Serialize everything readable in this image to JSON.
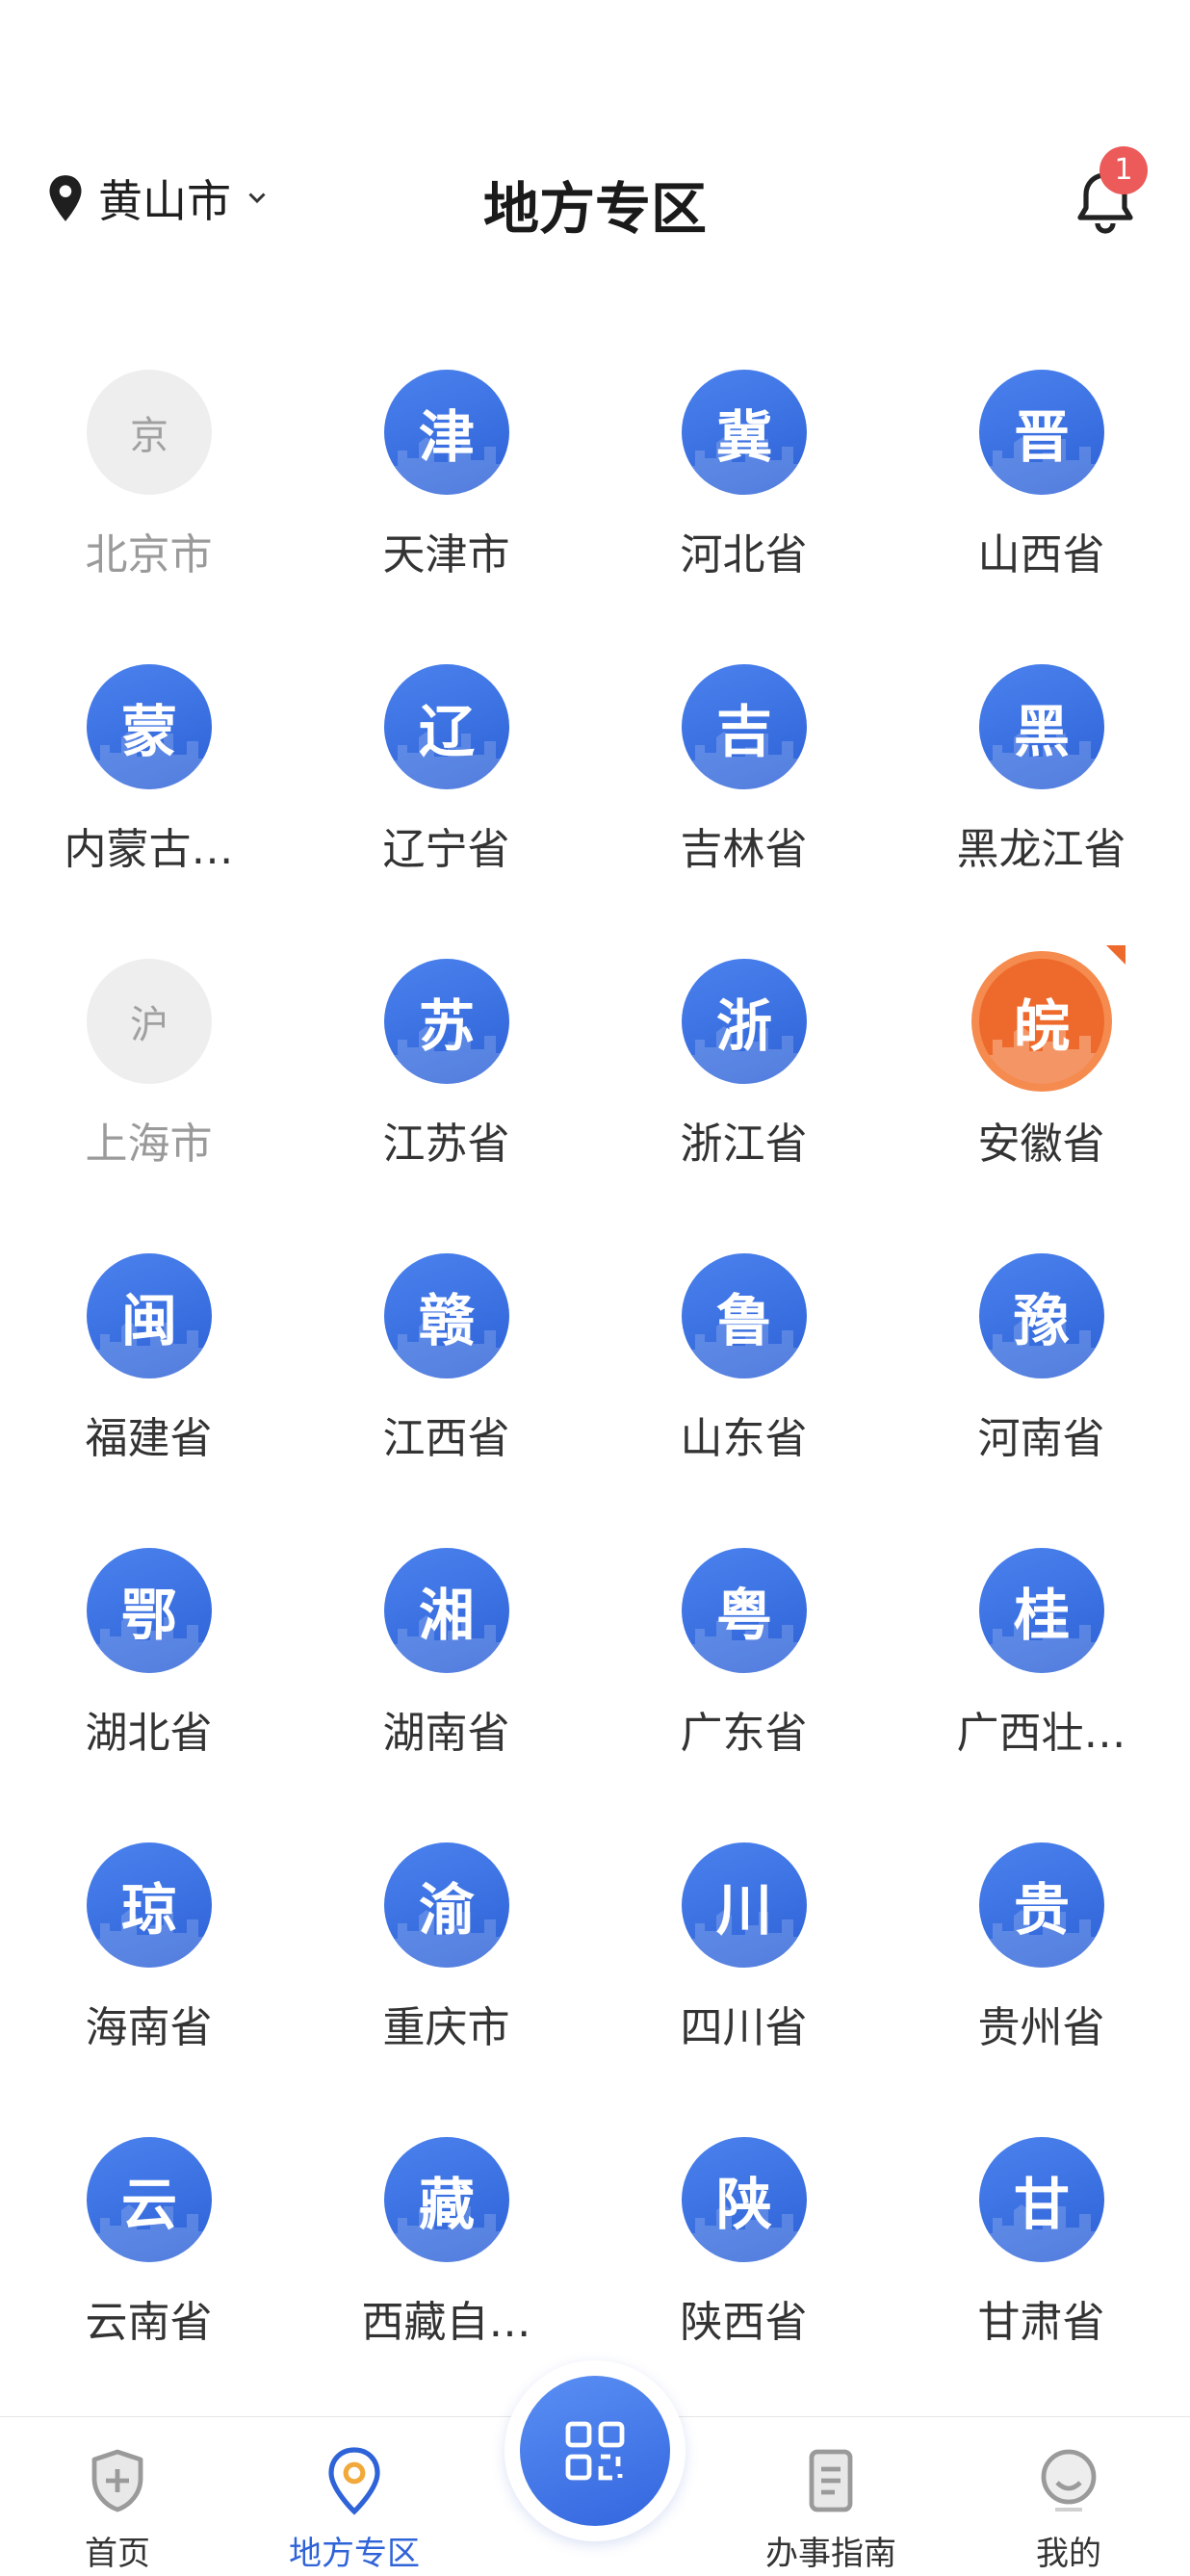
{
  "header": {
    "location": "黄山市",
    "title": "地方专区",
    "notification_count": "1"
  },
  "regions": [
    {
      "label": "北京市",
      "glyph": "京",
      "state": "inactive",
      "icon": "beijing-icon"
    },
    {
      "label": "天津市",
      "glyph": "津",
      "state": "active",
      "icon": "tianjin-icon"
    },
    {
      "label": "河北省",
      "glyph": "冀",
      "state": "active",
      "icon": "hebei-icon"
    },
    {
      "label": "山西省",
      "glyph": "晋",
      "state": "active",
      "icon": "shanxi-icon"
    },
    {
      "label": "内蒙古…",
      "glyph": "蒙",
      "state": "active",
      "icon": "neimenggu-icon"
    },
    {
      "label": "辽宁省",
      "glyph": "辽",
      "state": "active",
      "icon": "liaoning-icon"
    },
    {
      "label": "吉林省",
      "glyph": "吉",
      "state": "active",
      "icon": "jilin-icon"
    },
    {
      "label": "黑龙江省",
      "glyph": "黑",
      "state": "active",
      "icon": "heilongjiang-icon"
    },
    {
      "label": "上海市",
      "glyph": "沪",
      "state": "inactive",
      "icon": "shanghai-icon"
    },
    {
      "label": "江苏省",
      "glyph": "苏",
      "state": "active",
      "icon": "jiangsu-icon"
    },
    {
      "label": "浙江省",
      "glyph": "浙",
      "state": "active",
      "icon": "zhejiang-icon"
    },
    {
      "label": "安徽省",
      "glyph": "皖",
      "state": "selected",
      "icon": "anhui-icon"
    },
    {
      "label": "福建省",
      "glyph": "闽",
      "state": "active",
      "icon": "fujian-icon"
    },
    {
      "label": "江西省",
      "glyph": "赣",
      "state": "active",
      "icon": "jiangxi-icon"
    },
    {
      "label": "山东省",
      "glyph": "鲁",
      "state": "active",
      "icon": "shandong-icon"
    },
    {
      "label": "河南省",
      "glyph": "豫",
      "state": "active",
      "icon": "henan-icon"
    },
    {
      "label": "湖北省",
      "glyph": "鄂",
      "state": "active",
      "icon": "hubei-icon"
    },
    {
      "label": "湖南省",
      "glyph": "湘",
      "state": "active",
      "icon": "hunan-icon"
    },
    {
      "label": "广东省",
      "glyph": "粤",
      "state": "active",
      "icon": "guangdong-icon"
    },
    {
      "label": "广西壮…",
      "glyph": "桂",
      "state": "active",
      "icon": "guangxi-icon"
    },
    {
      "label": "海南省",
      "glyph": "琼",
      "state": "active",
      "icon": "hainan-icon"
    },
    {
      "label": "重庆市",
      "glyph": "渝",
      "state": "active",
      "icon": "chongqing-icon"
    },
    {
      "label": "四川省",
      "glyph": "川",
      "state": "active",
      "icon": "sichuan-icon"
    },
    {
      "label": "贵州省",
      "glyph": "贵",
      "state": "active",
      "icon": "guizhou-icon"
    },
    {
      "label": "云南省",
      "glyph": "云",
      "state": "active",
      "icon": "yunnan-icon"
    },
    {
      "label": "西藏自…",
      "glyph": "藏",
      "state": "active",
      "icon": "xizang-icon"
    },
    {
      "label": "陕西省",
      "glyph": "陕",
      "state": "active",
      "icon": "shaanxi-icon"
    },
    {
      "label": "甘肃省",
      "glyph": "甘",
      "state": "active",
      "icon": "gansu-icon"
    }
  ],
  "tabbar": {
    "home": "首页",
    "local": "地方专区",
    "guide": "办事指南",
    "mine": "我的",
    "active_tab": "local"
  },
  "colors": {
    "accent": "#2f63d8",
    "circle_blue": "#3a6fe0",
    "selected_orange": "#ee6a2c",
    "badge_red": "#ec5a5a",
    "inactive_gray": "#eeeeee"
  }
}
